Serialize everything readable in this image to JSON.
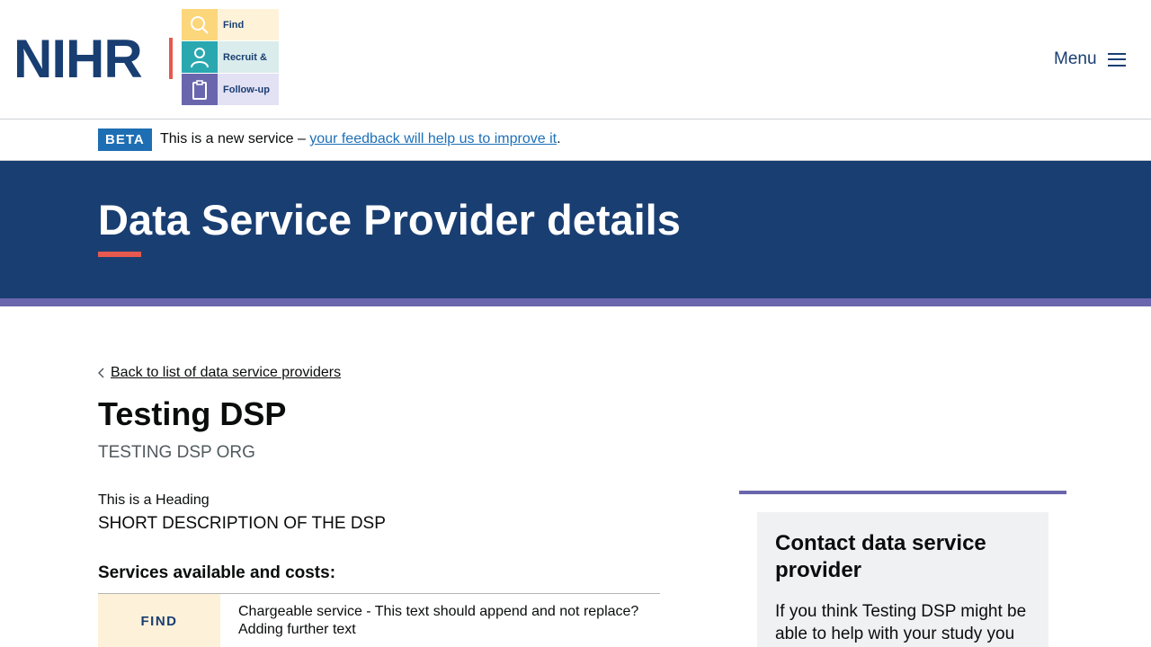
{
  "header": {
    "logo_text": "NIHR",
    "frf_items": [
      {
        "label": "Find",
        "icon": "search-icon",
        "icon_bg": "#fcd67b",
        "text_bg": "#fef2d9"
      },
      {
        "label": "Recruit &",
        "icon": "person-icon",
        "icon_bg": "#2aa8b0",
        "text_bg": "#dbecec"
      },
      {
        "label": "Follow-up",
        "icon": "clipboard-icon",
        "icon_bg": "#6a66ad",
        "text_bg": "#e3e1f4"
      }
    ],
    "menu_label": "Menu"
  },
  "beta": {
    "tag": "BETA",
    "text_prefix": "This is a new service – ",
    "link_text": "your feedback will help us to improve it",
    "text_suffix": "."
  },
  "hero": {
    "title": "Data Service Provider details"
  },
  "main": {
    "back_link": "Back to list of data service providers",
    "dsp_name": "Testing DSP",
    "org_name": "TESTING DSP ORG",
    "heading": "This is a Heading",
    "short_description": "SHORT DESCRIPTION OF THE DSP",
    "services_heading": "Services available and costs:",
    "services": [
      {
        "label": "FIND",
        "description": "Chargeable service - This text should append and not replace? Adding further text"
      }
    ]
  },
  "sidebar": {
    "contact_title": "Contact data service provider",
    "contact_text": "If you think Testing DSP might be able to help with your study you"
  },
  "colors": {
    "navy": "#193e72",
    "accent_red": "#e5594e",
    "purple": "#6a66ad",
    "link_blue": "#1d70b8"
  }
}
